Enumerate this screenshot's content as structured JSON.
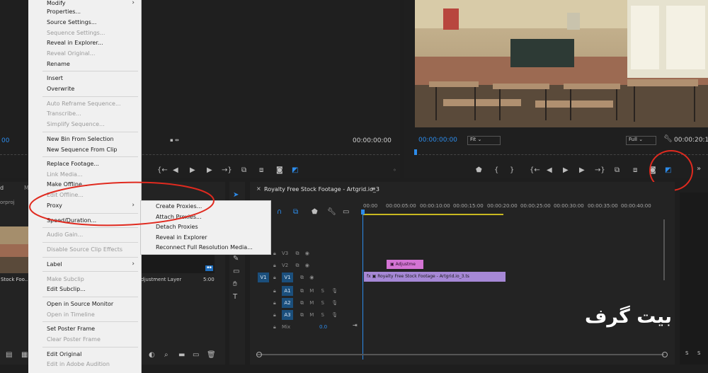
{
  "source_monitor": {
    "timecode_left": "00",
    "timecode_right": "00:00:00:00"
  },
  "program_monitor": {
    "timecode": "00:00:00:00",
    "fit": "Fit",
    "quality": "Full",
    "timecode_right": "00:00:20:13"
  },
  "project_panel": {
    "tab": "d",
    "tab2": "M",
    "file": "orproj",
    "clip_name": "Stock Foo...",
    "adjustment_name": "djustment Layer",
    "adjustment_duration": "5:00"
  },
  "context_menu": {
    "items": [
      {
        "label": "Modify",
        "enabled": true,
        "submenu": true
      },
      {
        "label": "Properties...",
        "enabled": true
      },
      {
        "label": "Source Settings...",
        "enabled": true
      },
      {
        "label": "Sequence Settings...",
        "enabled": false
      },
      {
        "label": "Reveal in Explorer...",
        "enabled": true
      },
      {
        "label": "Reveal Original...",
        "enabled": false
      },
      {
        "label": "Rename",
        "enabled": true
      },
      {
        "label": "Insert",
        "enabled": true
      },
      {
        "label": "Overwrite",
        "enabled": true
      },
      {
        "label": "Auto Reframe Sequence...",
        "enabled": false
      },
      {
        "label": "Transcribe...",
        "enabled": false
      },
      {
        "label": "Simplify Sequence...",
        "enabled": false
      },
      {
        "label": "New Bin From Selection",
        "enabled": true
      },
      {
        "label": "New Sequence From Clip",
        "enabled": true
      },
      {
        "label": "Replace Footage...",
        "enabled": true
      },
      {
        "label": "Link Media...",
        "enabled": false
      },
      {
        "label": "Make Offline...",
        "enabled": true
      },
      {
        "label": "Edit Offline...",
        "enabled": false
      },
      {
        "label": "Proxy",
        "enabled": true,
        "submenu": true
      },
      {
        "label": "Speed/Duration...",
        "enabled": true
      },
      {
        "label": "Audio Gain...",
        "enabled": false
      },
      {
        "label": "Disable Source Clip Effects",
        "enabled": false
      },
      {
        "label": "Label",
        "enabled": true,
        "submenu": true
      },
      {
        "label": "Make Subclip",
        "enabled": false
      },
      {
        "label": "Edit Subclip...",
        "enabled": true
      },
      {
        "label": "Open in Source Monitor",
        "enabled": true
      },
      {
        "label": "Open in Timeline",
        "enabled": false
      },
      {
        "label": "Set Poster Frame",
        "enabled": true
      },
      {
        "label": "Clear Poster Frame",
        "enabled": false
      },
      {
        "label": "Edit Original",
        "enabled": true
      },
      {
        "label": "Edit in Adobe Audition",
        "enabled": false
      }
    ]
  },
  "proxy_submenu": {
    "items": [
      "Create Proxies...",
      "Attach Proxies...",
      "Detach Proxies",
      "Reveal in Explorer",
      "Reconnect Full Resolution Media..."
    ]
  },
  "timeline": {
    "sequence_name": "Royalty Free Stock Footage - Artgrid.io_3",
    "playhead": "00:00",
    "ruler": [
      "00:00:05:00",
      "00:00:10:00",
      "00:00:15:00",
      "00:00:20:00",
      "00:00:25:00",
      "00:00:30:00",
      "00:00:35:00",
      "00:00:40:00"
    ],
    "tracks": [
      "V3",
      "V2",
      "V1",
      "A1",
      "A2",
      "A3"
    ],
    "source_v": "V1",
    "mix_label": "Mix",
    "mix_value": "0.0",
    "adjustment_clip": "Adjustme",
    "video_clip": "Royalty Free Stock Footage - Artgrid.io_3.ts",
    "fx_badge": "fx"
  },
  "watermark": "بیت گرف",
  "audio_meter": {
    "s1": "S",
    "s2": "S"
  }
}
